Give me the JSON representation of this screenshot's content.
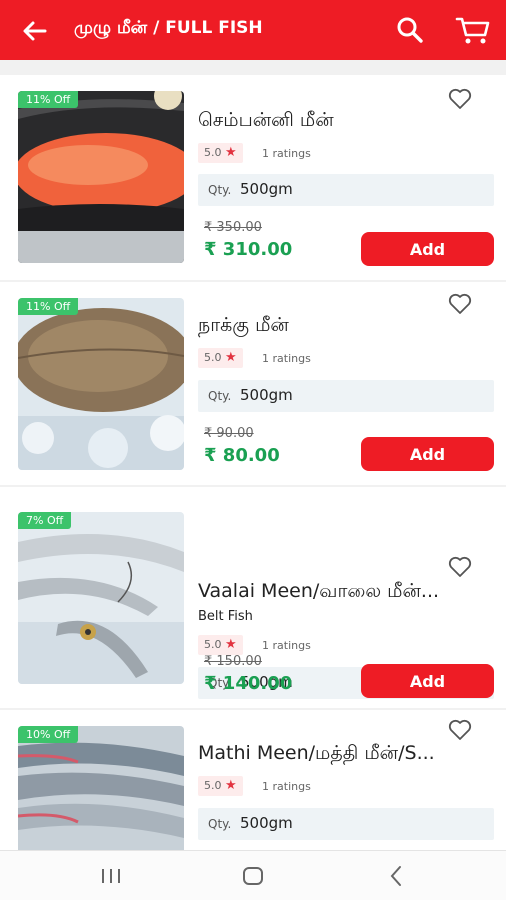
{
  "header": {
    "title": "முழு மீன் / FULL FISH",
    "back_icon": "arrow-left-icon",
    "search_icon": "search-icon",
    "cart_icon": "cart-icon",
    "bar_color": "#ee1c25"
  },
  "products": [
    {
      "discount": "11% Off",
      "name": "செம்பன்னி மீன்",
      "subtitle": "",
      "rating": "5.0",
      "ratings_count": "1 ratings",
      "qty_label": "Qty.",
      "qty_value": "500gm",
      "mrp": "₹ 350.00",
      "price": "₹ 310.00",
      "add_label": "Add"
    },
    {
      "discount": "11% Off",
      "name": "நாக்கு மீன்",
      "subtitle": "",
      "rating": "5.0",
      "ratings_count": "1 ratings",
      "qty_label": "Qty.",
      "qty_value": "500gm",
      "mrp": "₹ 90.00",
      "price": "₹ 80.00",
      "add_label": "Add"
    },
    {
      "discount": "7% Off",
      "name": "Vaalai Meen/வாலை மீன்...",
      "subtitle": "Belt Fish",
      "rating": "5.0",
      "ratings_count": "1 ratings",
      "qty_label": "Qty.",
      "qty_value": "500gm",
      "mrp": "₹ 150.00",
      "price": "₹ 140.00",
      "add_label": "Add"
    },
    {
      "discount": "10% Off",
      "name": "Mathi Meen/மத்தி மீன்/S...",
      "subtitle": "",
      "rating": "5.0",
      "ratings_count": "1 ratings",
      "qty_label": "Qty.",
      "qty_value": "500gm",
      "mrp": "",
      "price": "",
      "add_label": ""
    }
  ],
  "colors": {
    "accent": "#ee1c25",
    "discount_badge": "#3cc36b",
    "price": "#1aa052",
    "rating_star": "#e23340"
  },
  "navbar": {
    "recent_icon": "recent-apps-icon",
    "home_icon": "home-icon",
    "back_icon": "back-chevron-icon"
  }
}
